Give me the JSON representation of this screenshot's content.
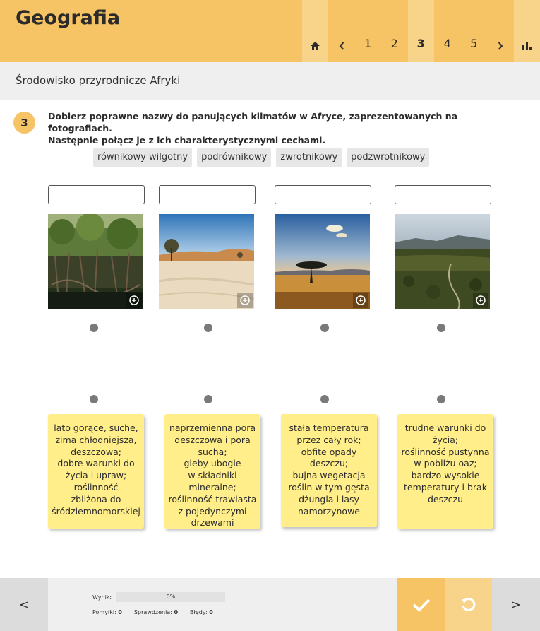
{
  "app": {
    "title": "Geografia"
  },
  "nav": {
    "pages": [
      "1",
      "2",
      "3",
      "4",
      "5"
    ],
    "current": "3"
  },
  "section": {
    "title": "Środowisko przyrodnicze Afryki"
  },
  "task": {
    "number": "3",
    "line1": "Dobierz poprawne nazwy do panujących klimatów w Afryce, zaprezentowanych na fotografiach.",
    "line2": "Następnie połącz je z ich charakterystycznymi cechami."
  },
  "chips": [
    "równikowy wilgotny",
    "podrównikowy",
    "zwrotnikowy",
    "podzwrotnikowy"
  ],
  "cards": [
    {
      "lines": [
        "lato gorące, suche,",
        "zima chłodniejsza,",
        "deszczowa;",
        "dobre warunki do",
        "życia i upraw;",
        "roślinność",
        "zbliżona do",
        "śródziemnomorskiej"
      ]
    },
    {
      "lines": [
        "naprzemienna pora",
        "deszczowa i pora",
        "sucha;",
        "gleby ubogie",
        "w składniki mineralne;",
        "roślinność trawiasta",
        "z pojedynczymi",
        "drzewami"
      ]
    },
    {
      "lines": [
        "stała temperatura",
        "przez cały rok;",
        "obfite opady deszczu;",
        "bujna wegetacja",
        "roślin w tym gęsta",
        "dżungla i lasy",
        "namorzynowe"
      ]
    },
    {
      "lines": [
        "trudne warunki do",
        "życia;",
        "roślinność pustynna",
        "w pobliżu oaz;",
        "bardzo wysokie",
        "temperatury i brak",
        "deszczu"
      ]
    }
  ],
  "footer": {
    "prev": "<",
    "next": ">",
    "score_label": "Wynik:",
    "score_value": "0%",
    "score_progress": 0,
    "mistakes_label": "Pomyłki:",
    "mistakes_value": "0",
    "checks_label": "Sprawdzenia:",
    "checks_value": "0",
    "errors_label": "Błędy:",
    "errors_value": "0"
  },
  "colors": {
    "accent": "#f6c464",
    "accent_light": "#f8d48b",
    "card": "#ffee8a",
    "dot": "#7a7a7a"
  }
}
